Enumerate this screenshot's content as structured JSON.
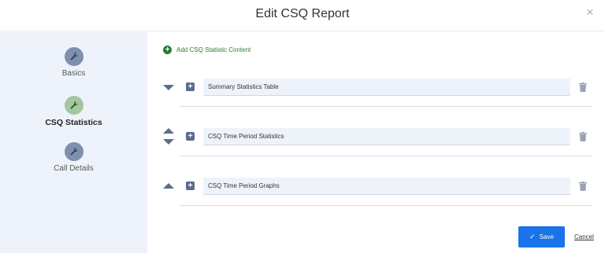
{
  "dialog": {
    "title": "Edit CSQ Report",
    "close_glyph": "×"
  },
  "sidebar": {
    "steps": [
      {
        "label": "Basics",
        "icon": "wrench-icon",
        "state": "default"
      },
      {
        "label": "CSQ Statistics",
        "icon": "wrench-icon",
        "state": "active"
      },
      {
        "label": "Call Details",
        "icon": "wrench-icon",
        "state": "default"
      }
    ]
  },
  "content": {
    "add_label": "Add CSQ Statistic Content",
    "rows": [
      {
        "name": "Summary Statistics Table",
        "arrows": [
          "down"
        ]
      },
      {
        "name": "CSQ Time Period Statistics",
        "arrows": [
          "up",
          "down"
        ]
      },
      {
        "name": "CSQ Time Period Graphs",
        "arrows": [
          "up"
        ]
      }
    ]
  },
  "footer": {
    "save_label": "Save",
    "cancel_label": "Cancel"
  },
  "colors": {
    "accent_blue": "#1a73e8",
    "add_green": "#2f7a34",
    "sidebar_bg": "#eef3fb",
    "step_default": "#7f8fae",
    "step_active": "#a5c79f"
  }
}
